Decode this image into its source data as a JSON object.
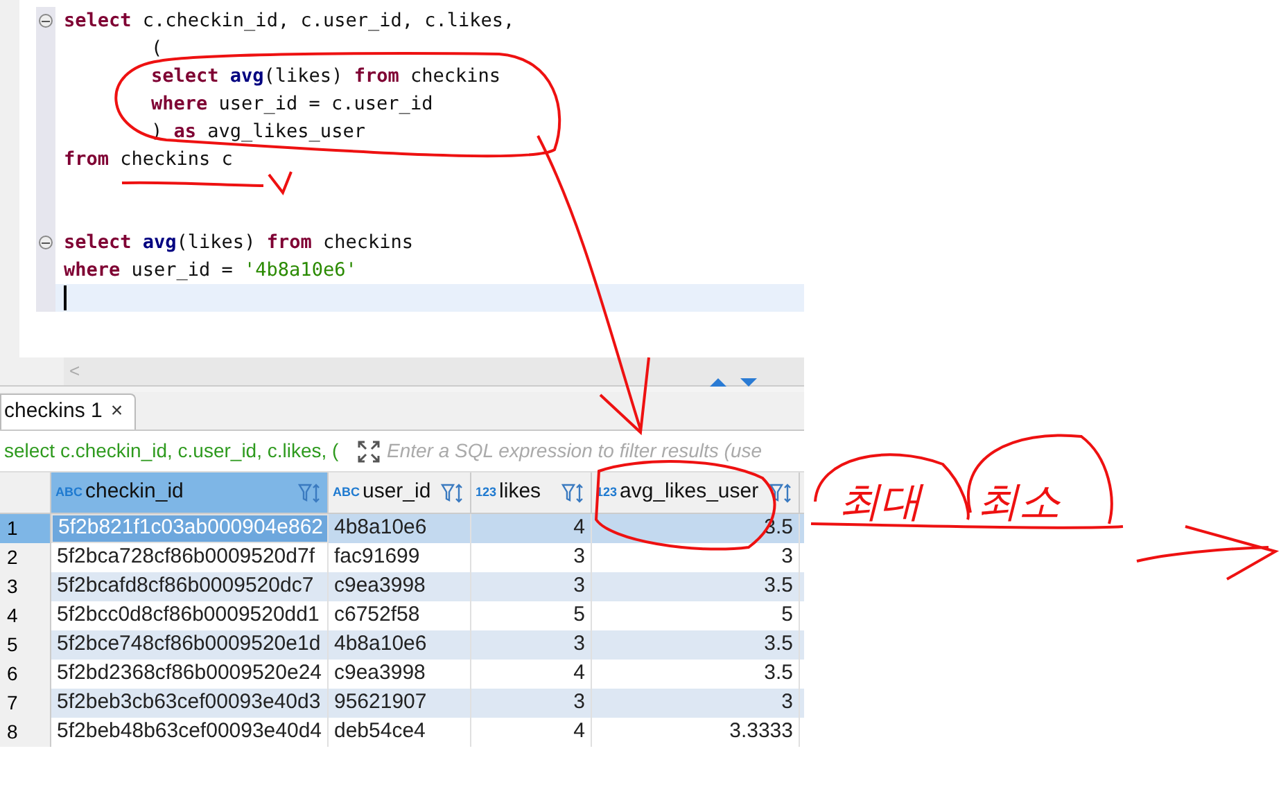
{
  "editor": {
    "lines": [
      {
        "fold": true,
        "current": false,
        "indent": false,
        "tokens": [
          {
            "kind": "keyword",
            "text": "select"
          },
          {
            "kind": "plain",
            "text": " c.checkin_id, c.user_id, c.likes,"
          }
        ]
      },
      {
        "fold": false,
        "current": false,
        "indent": true,
        "tokens": [
          {
            "kind": "plain",
            "text": "("
          }
        ]
      },
      {
        "fold": false,
        "current": false,
        "indent": true,
        "tokens": [
          {
            "kind": "keyword",
            "text": "select "
          },
          {
            "kind": "function",
            "text": "avg"
          },
          {
            "kind": "plain",
            "text": "(likes) "
          },
          {
            "kind": "keyword",
            "text": "from"
          },
          {
            "kind": "plain",
            "text": " checkins"
          }
        ]
      },
      {
        "fold": false,
        "current": false,
        "indent": true,
        "tokens": [
          {
            "kind": "keyword",
            "text": "where"
          },
          {
            "kind": "plain",
            "text": " user_id = c.user_id"
          }
        ]
      },
      {
        "fold": false,
        "current": false,
        "indent": true,
        "tokens": [
          {
            "kind": "plain",
            "text": ") "
          },
          {
            "kind": "keyword",
            "text": "as"
          },
          {
            "kind": "plain",
            "text": " avg_likes_user"
          }
        ]
      },
      {
        "fold": false,
        "current": false,
        "indent": false,
        "tokens": [
          {
            "kind": "keyword",
            "text": "from"
          },
          {
            "kind": "plain",
            "text": " checkins c"
          }
        ]
      },
      {
        "fold": false,
        "current": false
      },
      {
        "fold": false,
        "current": false
      },
      {
        "fold": true,
        "current": false,
        "indent": false,
        "tokens": [
          {
            "kind": "keyword",
            "text": "select "
          },
          {
            "kind": "function",
            "text": "avg"
          },
          {
            "kind": "plain",
            "text": "(likes) "
          },
          {
            "kind": "keyword",
            "text": "from"
          },
          {
            "kind": "plain",
            "text": " checkins"
          }
        ]
      },
      {
        "fold": false,
        "current": false,
        "indent": false,
        "tokens": [
          {
            "kind": "keyword",
            "text": "where"
          },
          {
            "kind": "plain",
            "text": " user_id = "
          },
          {
            "kind": "string",
            "text": "'4b8a10e6'"
          }
        ]
      },
      {
        "fold": false,
        "current": true,
        "indent": false
      }
    ],
    "scroll_left": "<"
  },
  "results_tab": {
    "label": "checkins 1",
    "close": "×",
    "selected": true
  },
  "filter_bar": {
    "query": "select c.checkin_id, c.user_id, c.likes, (",
    "placeholder": "Enter a SQL expression to filter results (use"
  },
  "table": {
    "columns": [
      {
        "type": "ABC",
        "name": "checkin_id",
        "selected": true,
        "kind": "text"
      },
      {
        "type": "ABC",
        "name": "user_id",
        "selected": false,
        "kind": "text"
      },
      {
        "type": "123",
        "name": "likes",
        "selected": false,
        "kind": "number"
      },
      {
        "type": "123",
        "name": "avg_likes_user",
        "selected": false,
        "kind": "number"
      }
    ],
    "rows": [
      {
        "num": "1",
        "selected": true,
        "cells": [
          "5f2b821f1c03ab000904e862",
          "4b8a10e6",
          "4",
          "3.5"
        ]
      },
      {
        "num": "2",
        "selected": false,
        "cells": [
          "5f2bca728cf86b0009520d7f",
          "fac91699",
          "3",
          "3"
        ]
      },
      {
        "num": "3",
        "selected": false,
        "cells": [
          "5f2bcafd8cf86b0009520dc7",
          "c9ea3998",
          "3",
          "3.5"
        ]
      },
      {
        "num": "4",
        "selected": false,
        "cells": [
          "5f2bcc0d8cf86b0009520dd1",
          "c6752f58",
          "5",
          "5"
        ]
      },
      {
        "num": "5",
        "selected": false,
        "cells": [
          "5f2bce748cf86b0009520e1d",
          "4b8a10e6",
          "3",
          "3.5"
        ]
      },
      {
        "num": "6",
        "selected": false,
        "cells": [
          "5f2bd2368cf86b0009520e24",
          "c9ea3998",
          "4",
          "3.5"
        ]
      },
      {
        "num": "7",
        "selected": false,
        "cells": [
          "5f2beb3cb63cef00093e40d3",
          "95621907",
          "3",
          "3"
        ]
      },
      {
        "num": "8",
        "selected": false,
        "cells": [
          "5f2beb48b63cef00093e40d4",
          "deb54ce4",
          "4",
          "3.3333"
        ]
      }
    ]
  },
  "annotations": {
    "labels": [
      "최대",
      "최소"
    ]
  }
}
